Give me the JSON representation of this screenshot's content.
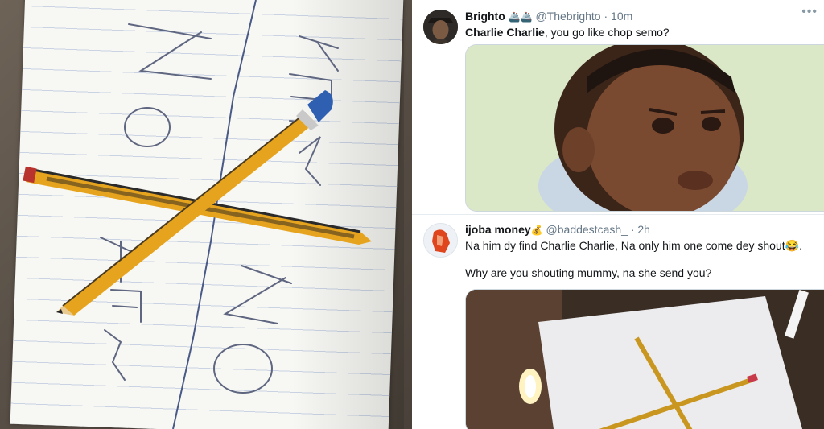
{
  "left_photo": {
    "board_words": [
      "NO",
      "YES",
      "YES",
      "NO"
    ]
  },
  "tweets": [
    {
      "display_name": "Brighto",
      "name_emoji": "🚢🚢",
      "handle": "@Thebrighto",
      "separator": "·",
      "time": "10m",
      "more": "•••",
      "text_mention": "Charlie Charlie",
      "text_rest": ", you go like chop semo?",
      "media": "reaction-baby-face-gif"
    },
    {
      "display_name": "ijoba money",
      "name_emoji": "💰",
      "handle": "@baddestcash_",
      "separator": "·",
      "time": "2h",
      "text_line1": "Na him dy find Charlie Charlie, Na only him one come dey shout😂.",
      "text_line2": "Why are you shouting mummy, na she send you?",
      "media": "charlie-charlie-candle-photo"
    }
  ],
  "colors": {
    "text_primary": "#14171a",
    "text_secondary": "#657786",
    "border": "#e6ecf0",
    "pencil_yellow": "#e6a41e",
    "pencil_eraser": "#2f5fb0"
  }
}
